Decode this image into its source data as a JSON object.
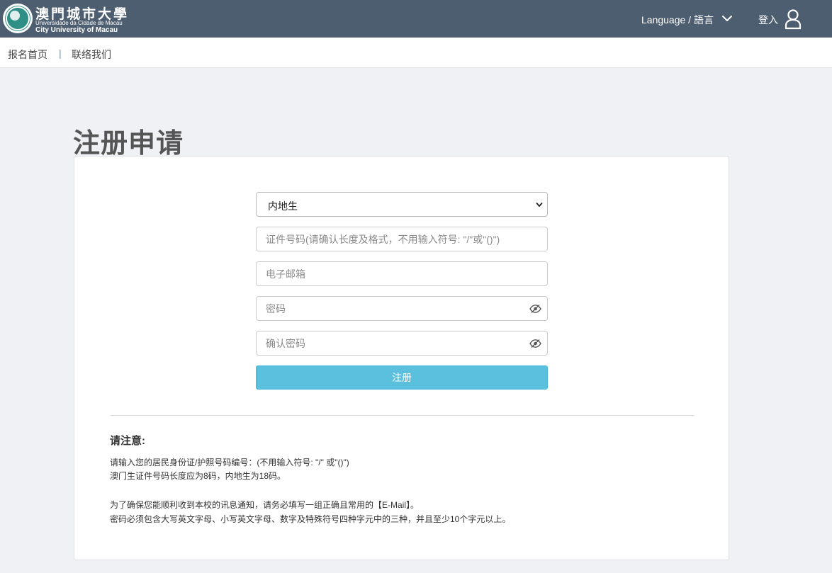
{
  "header": {
    "logo": {
      "name_cn": "澳門城市大學",
      "name_pt": "Universidade da Cidade de Macau",
      "name_en": "City University of Macau"
    },
    "language_label": "Language / 語言",
    "language_icon": "chevron-down-icon",
    "login_label": "登入",
    "login_icon": "user-icon",
    "bg_color": "#4d5e70"
  },
  "nav": {
    "home": "报名首页",
    "separator": "|",
    "contact": "联络我们"
  },
  "page": {
    "title": "注册申请"
  },
  "form": {
    "student_type": {
      "selected": "内地生"
    },
    "id_number": {
      "placeholder": "证件号码(请确认长度及格式，不用输入符号: \"/\"或\"()\")",
      "value": ""
    },
    "email": {
      "placeholder": "电子邮箱",
      "value": ""
    },
    "password": {
      "placeholder": "密码",
      "value": "",
      "icon": "eye-icon"
    },
    "confirm_password": {
      "placeholder": "确认密码",
      "value": "",
      "icon": "eye-icon"
    },
    "submit_label": "注册",
    "submit_color": "#5bc0de"
  },
  "notice": {
    "title": "请注意:",
    "lines": [
      "请输入您的居民身份证/护照号码编号：(不用输入符号: \"/\" 或\"()\")",
      "澳门生证件号码长度应为8码，内地生为18码。",
      "为了确保您能顺利收到本校的讯息通知，请务必填写一组正确且常用的【E-Mail】。",
      "密码必须包含大写英文字母、小写英文字母、数字及特殊符号四种字元中的三种，并且至少10个字元以上。"
    ]
  }
}
